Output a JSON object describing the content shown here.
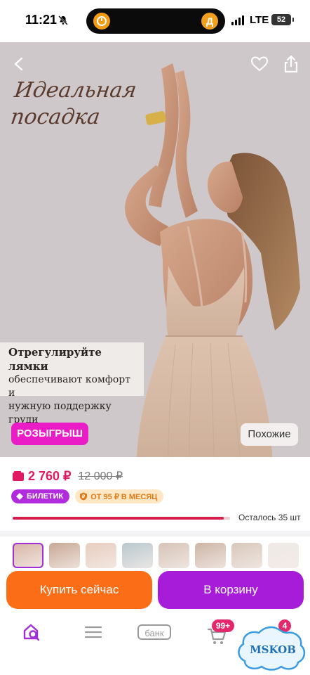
{
  "status_bar": {
    "time": "11:21",
    "network": "LTE",
    "battery": "52",
    "island_right_letter": "Д"
  },
  "hero": {
    "headline_line1": "Идеальная",
    "headline_line2": "посадка",
    "info_title": "Отрегулируйте лямки",
    "info_line1": "обеспечивают комфорт и",
    "info_line2": "нужную поддержку груди",
    "raffle_label": "РОЗЫГРЫШ",
    "similar_label": "Похожие"
  },
  "product": {
    "price_current": "2 760 ₽",
    "price_old": "12 000 ₽",
    "badge_ticket": "БИЛЕТИК",
    "badge_installment": "ОТ 95 ₽ В МЕСЯЦ",
    "stock_remaining": "Осталось 35 шт",
    "stock_fill_fraction": 0.97,
    "colors": {
      "price": "#e01b63",
      "ticket": "#b12cdc",
      "installment_bg": "#fde7c4",
      "progress": "#d51e49"
    }
  },
  "thumbnails": [
    {
      "color": "#d9b7a8",
      "selected": true
    },
    {
      "color": "#c9a895",
      "selected": false
    },
    {
      "color": "#e8cdbf",
      "selected": false
    },
    {
      "color": "#b9c8cf",
      "selected": false
    },
    {
      "color": "#d6c3b7",
      "selected": false
    },
    {
      "color": "#cdb4a6",
      "selected": false
    },
    {
      "color": "#d8c7bb",
      "selected": false
    },
    {
      "color": "#efe9e5",
      "selected": false
    }
  ],
  "actions": {
    "buy_now": "Купить сейчас",
    "add_to_cart": "В корзину"
  },
  "bottom_nav": {
    "bank_label": "банк",
    "cart_badge": "99+",
    "profile_badge": "4",
    "watermark": "MSKOB"
  }
}
